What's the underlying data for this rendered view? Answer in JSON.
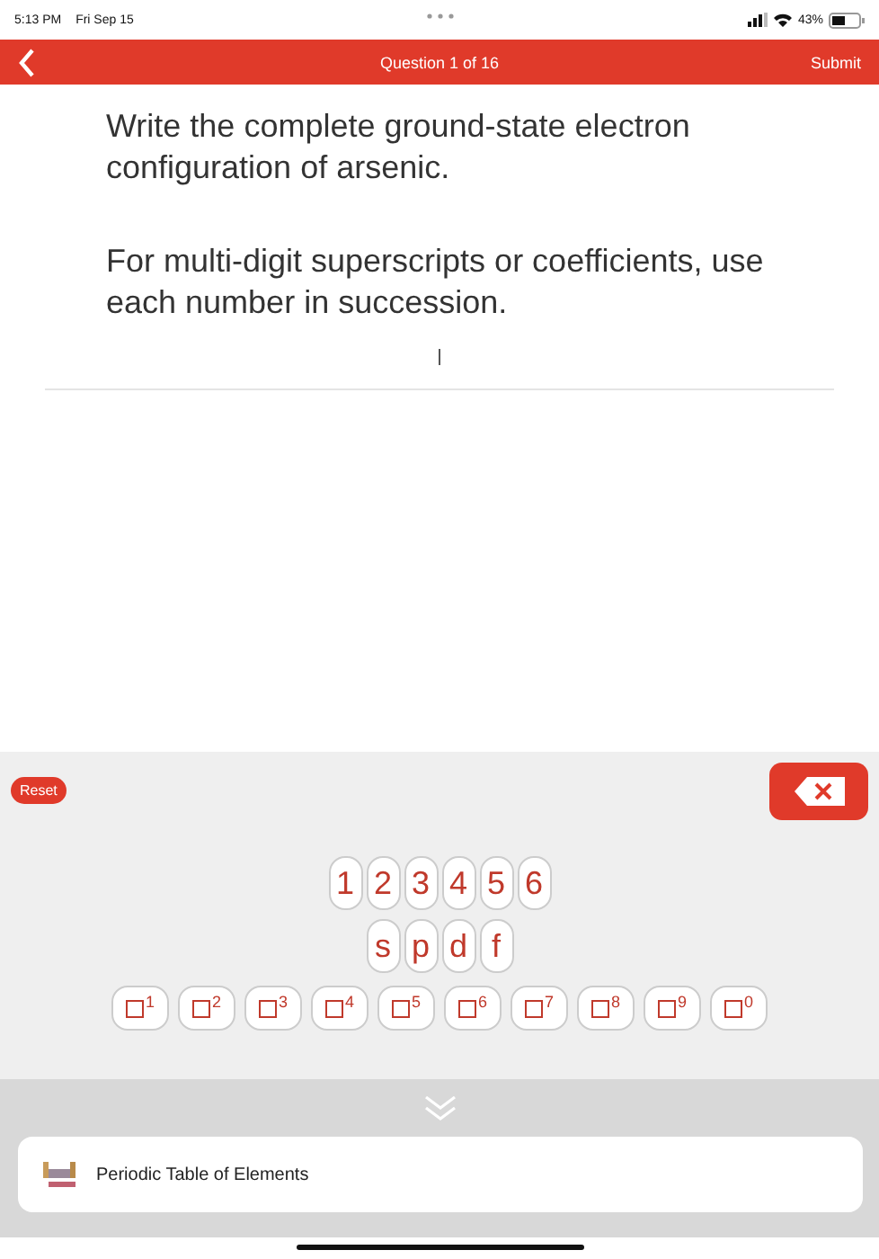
{
  "status_bar": {
    "time": "5:13 PM",
    "date": "Fri Sep 15",
    "battery": "43%"
  },
  "header": {
    "title": "Question 1 of 16",
    "submit": "Submit"
  },
  "question": {
    "prompt": "Write the complete ground-state electron configuration of arsenic.",
    "hint": "For multi-digit superscripts or coefficients, use each number in succession."
  },
  "keypad": {
    "reset": "Reset",
    "coefficients": [
      "1",
      "2",
      "3",
      "4",
      "5",
      "6"
    ],
    "orbitals": [
      "s",
      "p",
      "d",
      "f"
    ],
    "superscripts": [
      "1",
      "2",
      "3",
      "4",
      "5",
      "6",
      "7",
      "8",
      "9",
      "0"
    ]
  },
  "tools": [
    {
      "label": "Periodic Table of Elements"
    }
  ]
}
